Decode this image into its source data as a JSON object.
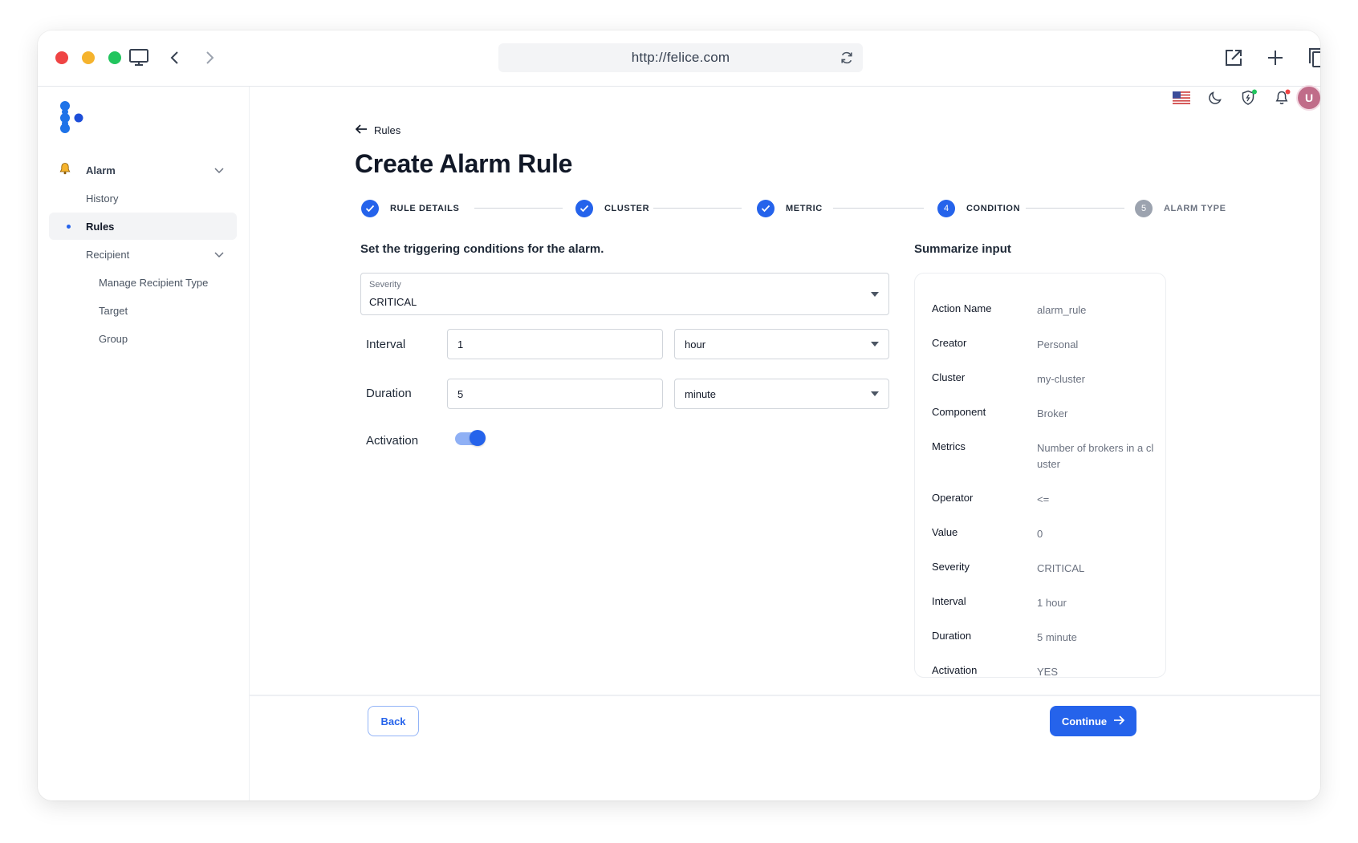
{
  "browser": {
    "url": "http://felice.com"
  },
  "sidebar": {
    "items": [
      {
        "label": "Alarm"
      },
      {
        "label": "History"
      },
      {
        "label": "Rules"
      },
      {
        "label": "Recipient"
      },
      {
        "label": "Manage Recipient Type"
      },
      {
        "label": "Target"
      },
      {
        "label": "Group"
      }
    ]
  },
  "header": {
    "avatar_initial": "U"
  },
  "breadcrumb": {
    "back_label": "Rules"
  },
  "page": {
    "title": "Create Alarm Rule"
  },
  "stepper": {
    "steps": [
      {
        "label": "RULE DETAILS",
        "state": "done"
      },
      {
        "label": "CLUSTER",
        "state": "done"
      },
      {
        "label": "METRIC",
        "state": "done"
      },
      {
        "label": "CONDITION",
        "number": "4",
        "state": "current"
      },
      {
        "label": "ALARM TYPE",
        "number": "5",
        "state": "pending"
      }
    ]
  },
  "form": {
    "title": "Set the triggering conditions for the alarm.",
    "severity": {
      "label": "Severity",
      "value": "CRITICAL"
    },
    "interval": {
      "label": "Interval",
      "value": "1",
      "unit": "hour"
    },
    "duration": {
      "label": "Duration",
      "value": "5",
      "unit": "minute"
    },
    "activation": {
      "label": "Activation",
      "on": true
    }
  },
  "summary": {
    "title": "Summarize input",
    "rows": [
      {
        "key": "Action Name",
        "value": "alarm_rule"
      },
      {
        "key": "Creator",
        "value": "Personal"
      },
      {
        "key": "Cluster",
        "value": "my-cluster"
      },
      {
        "key": "Component",
        "value": "Broker"
      },
      {
        "key": "Metrics",
        "value": "Number of brokers in a cluster"
      },
      {
        "key": "Operator",
        "value": "<="
      },
      {
        "key": "Value",
        "value": "0"
      },
      {
        "key": "Severity",
        "value": "CRITICAL"
      },
      {
        "key": "Interval",
        "value": "1 hour"
      },
      {
        "key": "Duration",
        "value": "5 minute"
      },
      {
        "key": "Activation",
        "value": "YES"
      }
    ]
  },
  "footer": {
    "back_label": "Back",
    "continue_label": "Continue"
  },
  "colors": {
    "primary": "#2563eb",
    "avatar": "#c06c89"
  },
  "icons": [
    "monitor-icon",
    "chevron-left-icon",
    "chevron-right-icon",
    "reload-icon",
    "external-link-icon",
    "plus-icon",
    "copy-icon",
    "flag-us-icon",
    "moon-icon",
    "shield-icon",
    "bell-icon",
    "arrow-left-icon",
    "arrow-right-icon",
    "check-icon",
    "chevron-down-icon"
  ]
}
